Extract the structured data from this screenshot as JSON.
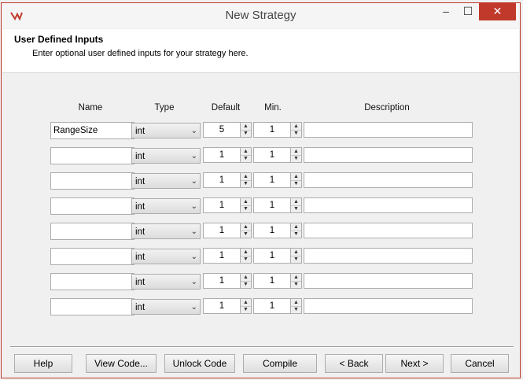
{
  "window": {
    "title": "New Strategy",
    "minimize_glyph": "‒",
    "maximize_glyph": "☐",
    "close_glyph": "✕"
  },
  "header": {
    "title": "User Defined Inputs",
    "subtitle": "Enter optional user defined inputs for your strategy here."
  },
  "columns": {
    "name": "Name",
    "type": "Type",
    "default": "Default",
    "min": "Min.",
    "description": "Description"
  },
  "inputs": [
    {
      "name": "RangeSize",
      "type": "int",
      "default": "5",
      "min": "1",
      "description": ""
    },
    {
      "name": "",
      "type": "int",
      "default": "1",
      "min": "1",
      "description": ""
    },
    {
      "name": "",
      "type": "int",
      "default": "1",
      "min": "1",
      "description": ""
    },
    {
      "name": "",
      "type": "int",
      "default": "1",
      "min": "1",
      "description": ""
    },
    {
      "name": "",
      "type": "int",
      "default": "1",
      "min": "1",
      "description": ""
    },
    {
      "name": "",
      "type": "int",
      "default": "1",
      "min": "1",
      "description": ""
    },
    {
      "name": "",
      "type": "int",
      "default": "1",
      "min": "1",
      "description": ""
    },
    {
      "name": "",
      "type": "int",
      "default": "1",
      "min": "1",
      "description": ""
    }
  ],
  "buttons": {
    "help": "Help",
    "view_code": "View Code...",
    "unlock_code": "Unlock Code",
    "compile": "Compile",
    "back": "< Back",
    "next": "Next >",
    "cancel": "Cancel"
  },
  "colors": {
    "close_button": "#c0392b",
    "logo": "#c0392b"
  }
}
